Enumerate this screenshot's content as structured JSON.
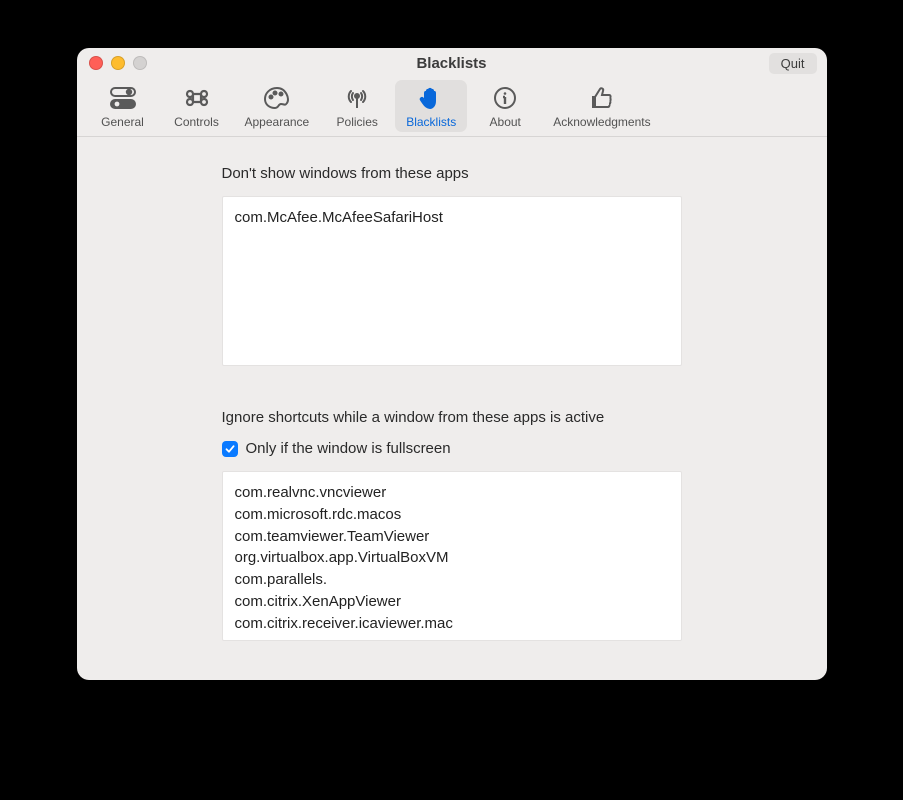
{
  "window": {
    "title": "Blacklists",
    "quit_label": "Quit"
  },
  "tabs": {
    "general": "General",
    "controls": "Controls",
    "appearance": "Appearance",
    "policies": "Policies",
    "blacklists": "Blacklists",
    "about": "About",
    "acknowledgments": "Acknowledgments"
  },
  "section1": {
    "label": "Don't show windows from these apps",
    "value": "com.McAfee.McAfeeSafariHost"
  },
  "section2": {
    "label": "Ignore shortcuts while a window from these apps is active",
    "checkbox_label": "Only if the window is fullscreen",
    "value": "com.realvnc.vncviewer\ncom.microsoft.rdc.macos\ncom.teamviewer.TeamViewer\norg.virtualbox.app.VirtualBoxVM\ncom.parallels.\ncom.citrix.XenAppViewer\ncom.citrix.receiver.icaviewer.mac"
  }
}
